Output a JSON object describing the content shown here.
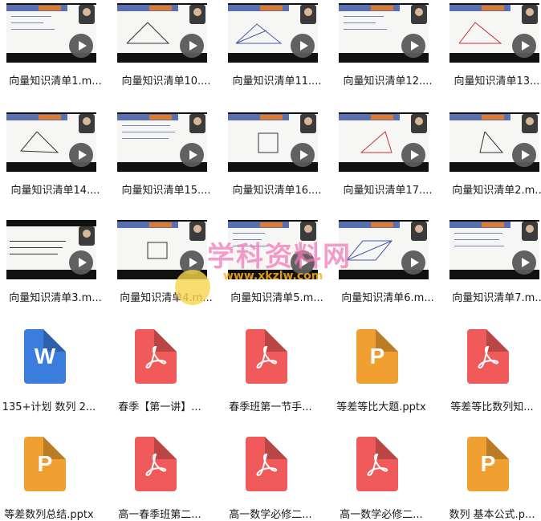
{
  "videos": [
    {
      "label": "向量知识清单1.m..."
    },
    {
      "label": "向量知识清单10...."
    },
    {
      "label": "向量知识清单11...."
    },
    {
      "label": "向量知识清单12...."
    },
    {
      "label": "向量知识清单13...."
    },
    {
      "label": "向量知识清单14...."
    },
    {
      "label": "向量知识清单15...."
    },
    {
      "label": "向量知识清单16...."
    },
    {
      "label": "向量知识清单17...."
    },
    {
      "label": "向量知识清单2.m..."
    },
    {
      "label": "向量知识清单3.m..."
    },
    {
      "label": "向量知识清单4.m..."
    },
    {
      "label": "向量知识清单5.m..."
    },
    {
      "label": "向量知识清单6.m..."
    },
    {
      "label": "向量知识清单7.m..."
    }
  ],
  "documents": [
    {
      "label": "135+计划 数列 2...",
      "icon": "word-icon",
      "glyph": "W"
    },
    {
      "label": "春季【第一讲】...",
      "icon": "pdf-icon",
      "glyph": ""
    },
    {
      "label": "春季班第一节手...",
      "icon": "pdf-icon",
      "glyph": ""
    },
    {
      "label": "等差等比大题.pptx",
      "icon": "ppt-icon",
      "glyph": "P"
    },
    {
      "label": "等差等比数列知...",
      "icon": "pdf-icon",
      "glyph": ""
    },
    {
      "label": "等差数列总结.pptx",
      "icon": "ppt-icon",
      "glyph": "P"
    },
    {
      "label": "高一春季班第二...",
      "icon": "pdf-icon",
      "glyph": ""
    },
    {
      "label": "高一数学必修二...",
      "icon": "pdf-icon",
      "glyph": ""
    },
    {
      "label": "高一数学必修二...",
      "icon": "pdf-icon",
      "glyph": ""
    },
    {
      "label": "数列 基本公式.p...",
      "icon": "ppt-icon",
      "glyph": "P"
    }
  ],
  "watermark": {
    "text": "学科资料网",
    "url": "www.xkzlw.com"
  },
  "colors": {
    "word": "#3b7ddd",
    "ppt": "#f0a030",
    "pdf": "#f05a5a",
    "play": "#5a5a5a"
  }
}
